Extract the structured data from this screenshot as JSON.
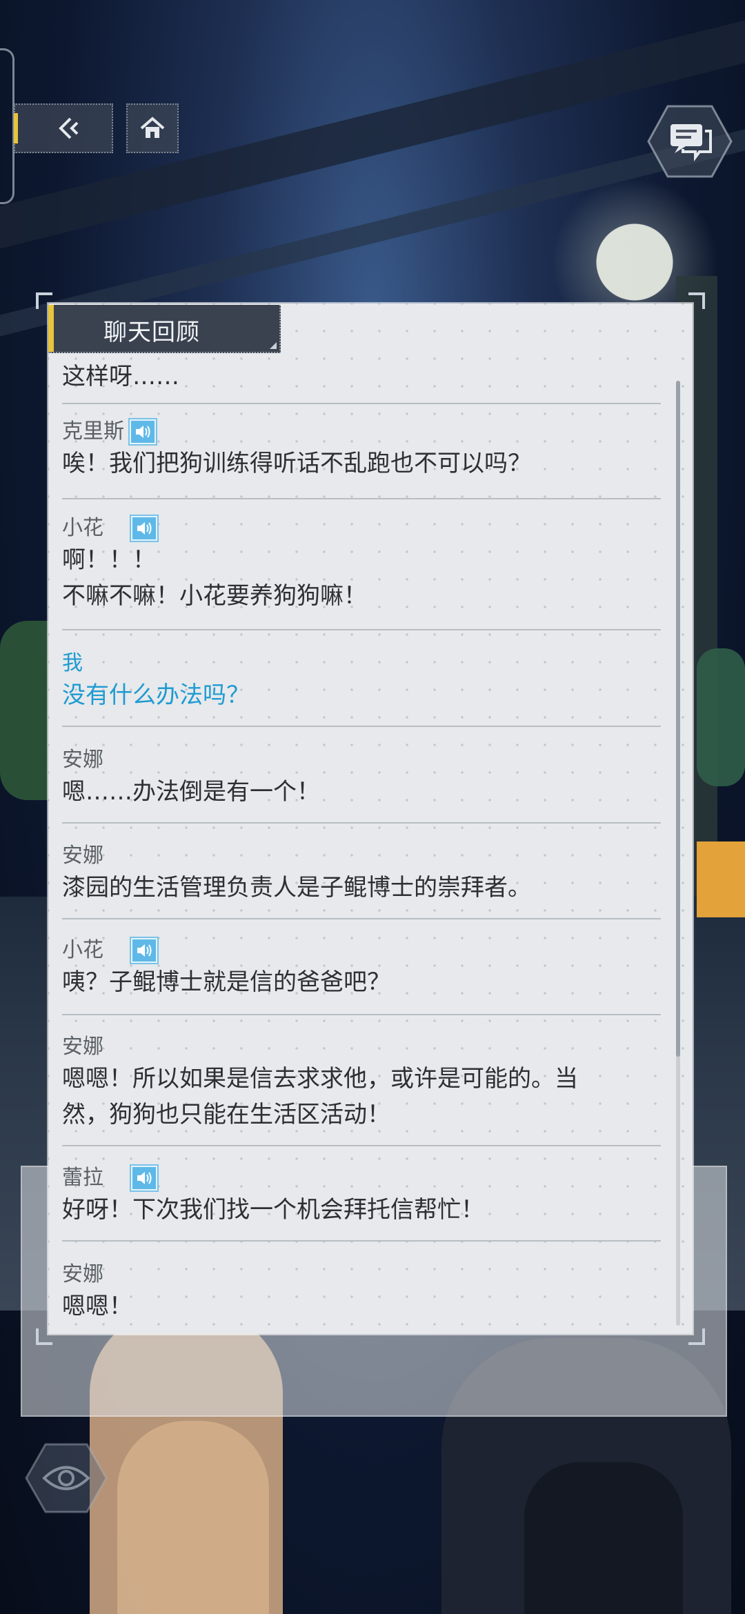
{
  "panel": {
    "title": "聊天回顾"
  },
  "log": [
    {
      "speaker": "",
      "text": "这样呀……",
      "voice": false,
      "is_me": false
    },
    {
      "speaker": "克里斯",
      "text": "唉！我们把狗训练得听话不乱跑也不可以吗？",
      "voice": true,
      "is_me": false
    },
    {
      "speaker": "小花",
      "text": "啊！！！",
      "text2": "不嘛不嘛！小花要养狗狗嘛！",
      "voice": true,
      "is_me": false
    },
    {
      "speaker": "我",
      "text": "没有什么办法吗？",
      "voice": false,
      "is_me": true
    },
    {
      "speaker": "安娜",
      "text": "嗯……办法倒是有一个！",
      "voice": false,
      "is_me": false
    },
    {
      "speaker": "安娜",
      "text": "漆园的生活管理负责人是子鲲博士的崇拜者。",
      "voice": false,
      "is_me": false
    },
    {
      "speaker": "小花",
      "text": "咦？子鲲博士就是信的爸爸吧？",
      "voice": true,
      "is_me": false
    },
    {
      "speaker": "安娜",
      "text": "嗯嗯！所以如果是信去求求他，或许是可能的。当",
      "text2": "然，狗狗也只能在生活区活动！",
      "voice": false,
      "is_me": false
    },
    {
      "speaker": "蕾拉",
      "text": "好呀！下次我们找一个机会拜托信帮忙！",
      "voice": true,
      "is_me": false
    },
    {
      "speaker": "安娜",
      "text": "嗯嗯！",
      "voice": false,
      "is_me": false
    }
  ],
  "colors": {
    "accent": "#e8c53a",
    "player_text": "#1f9bd1",
    "voice_icon": "#5fb9e8"
  },
  "icons": {
    "back": "rewind-back-icon",
    "home": "home-icon",
    "chat": "chat-log-icon",
    "voice": "speaker-volume-icon",
    "hide": "eye-icon"
  }
}
